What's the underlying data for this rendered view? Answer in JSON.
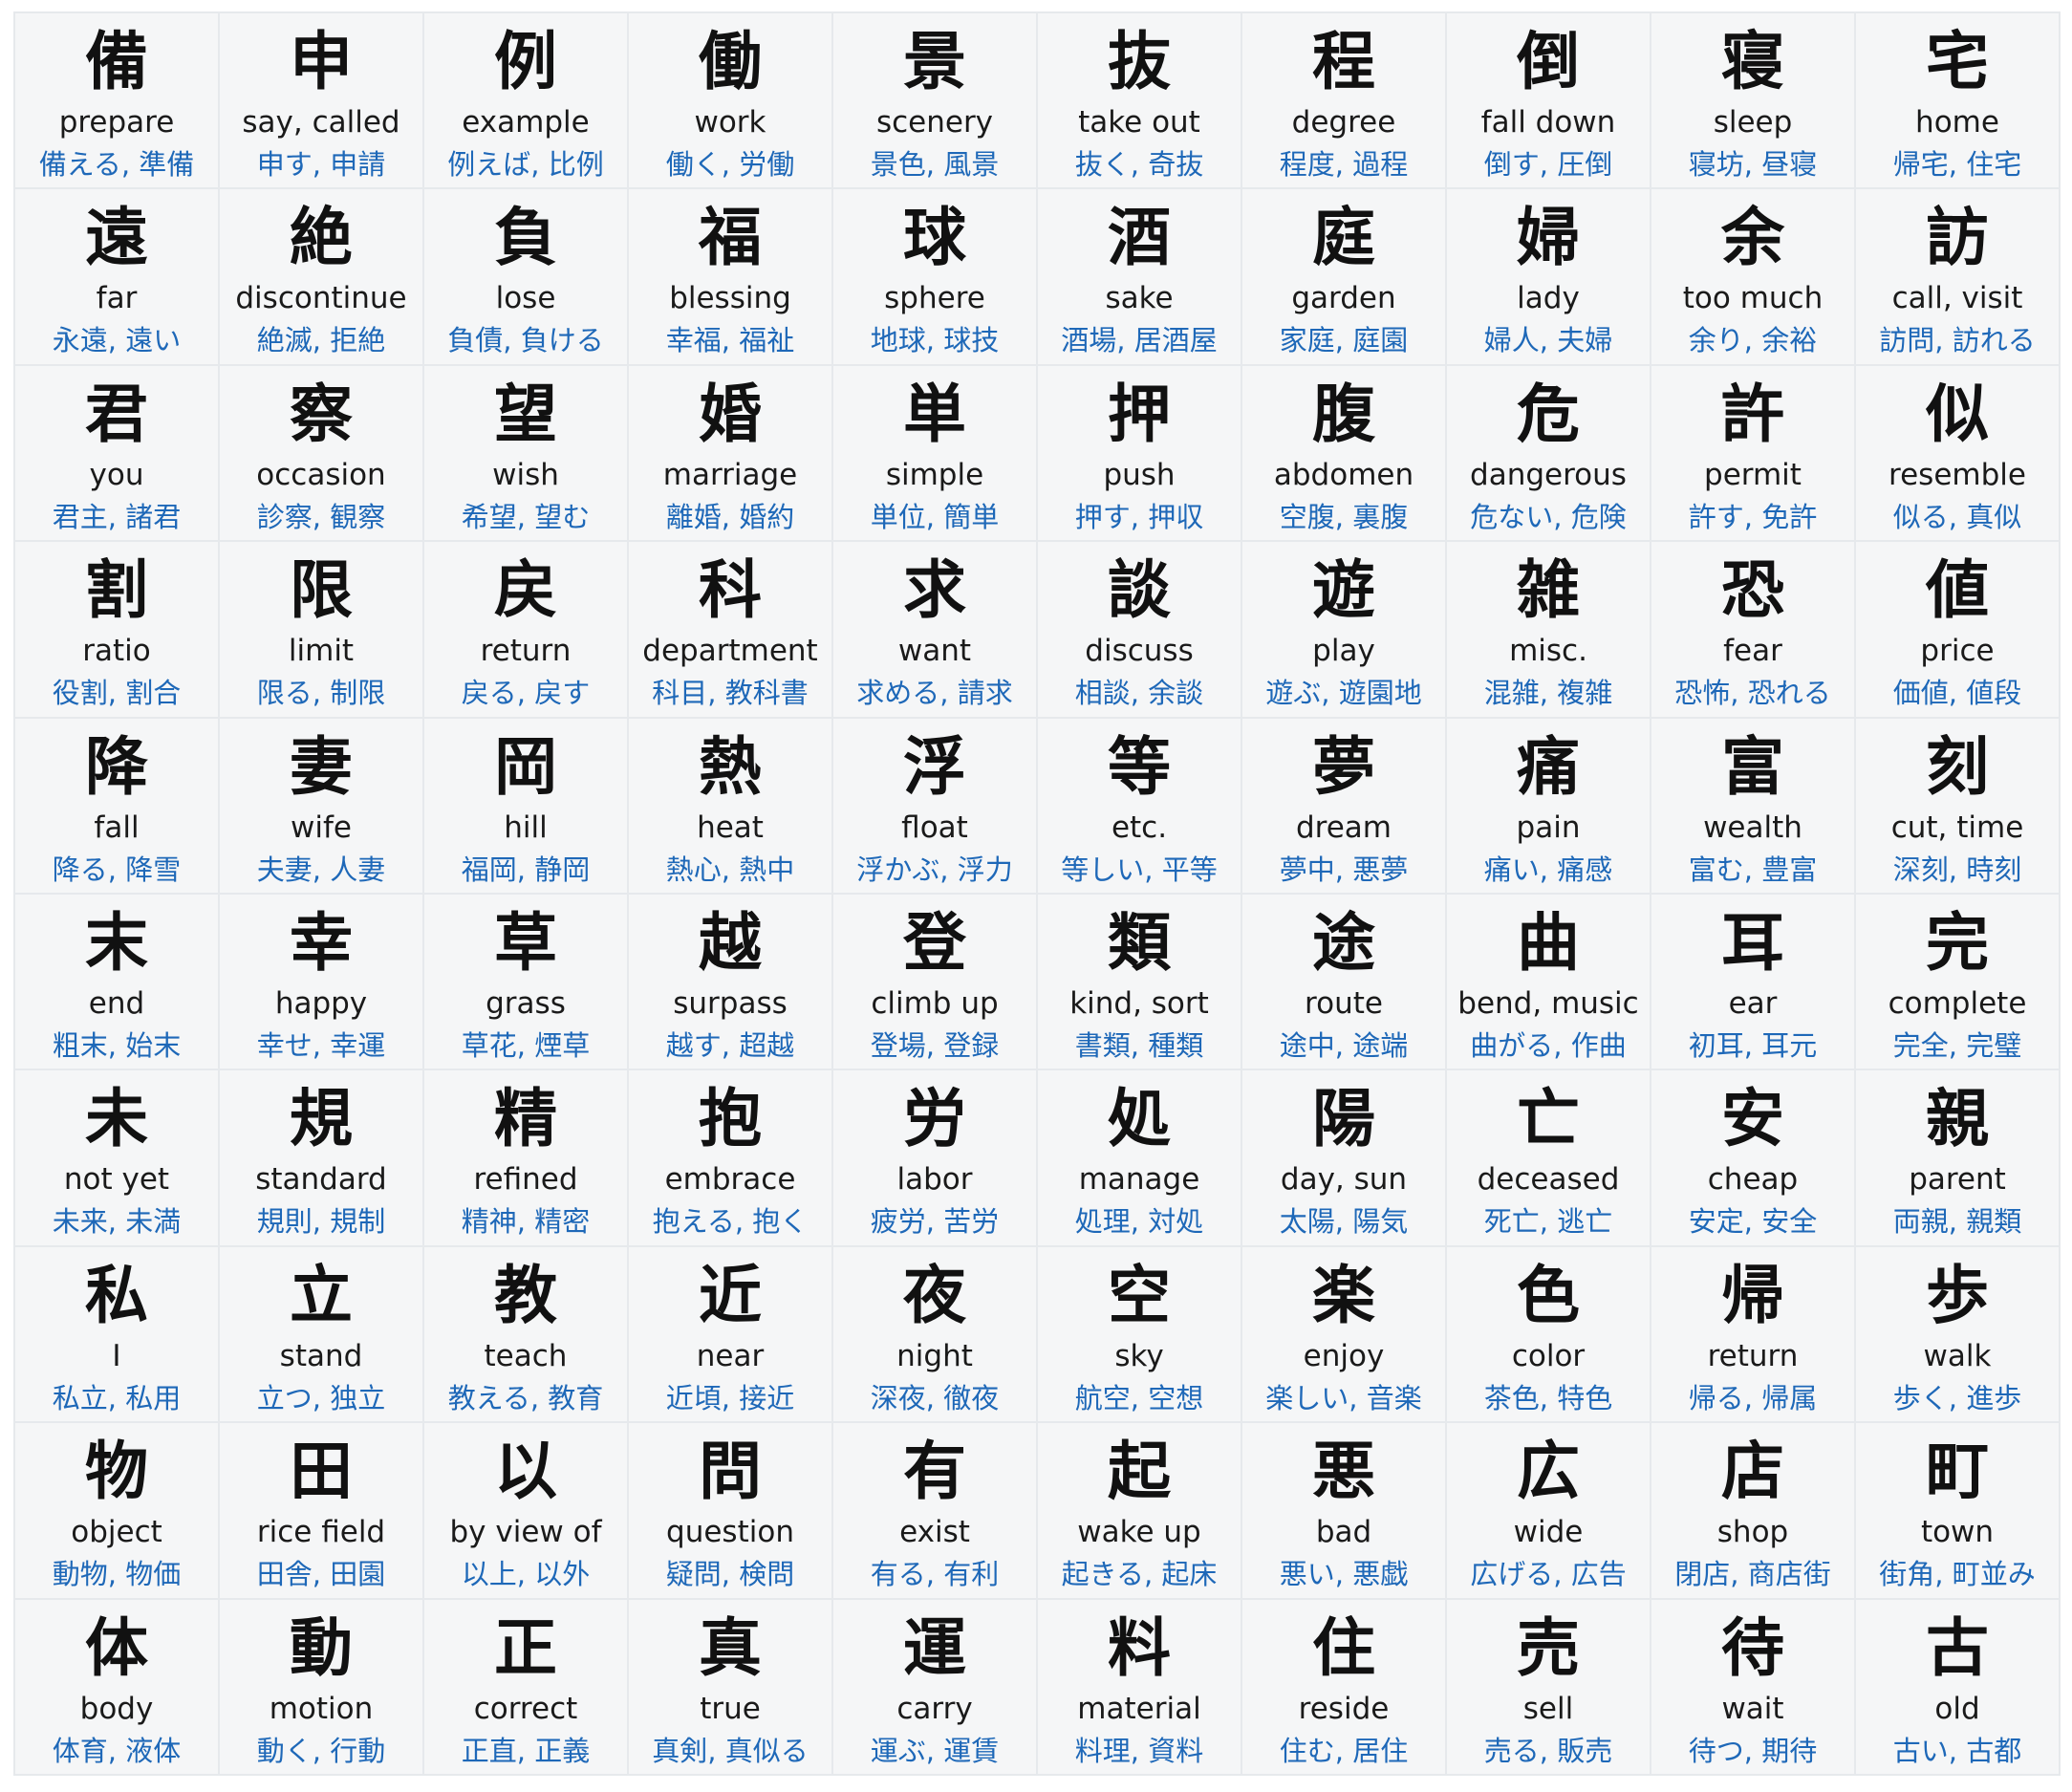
{
  "cells": [
    {
      "kanji": "備",
      "meaning": "prepare",
      "examples": "備える, 準備"
    },
    {
      "kanji": "申",
      "meaning": "say, called",
      "examples": "申す, 申請"
    },
    {
      "kanji": "例",
      "meaning": "example",
      "examples": "例えば, 比例"
    },
    {
      "kanji": "働",
      "meaning": "work",
      "examples": "働く, 労働"
    },
    {
      "kanji": "景",
      "meaning": "scenery",
      "examples": "景色, 風景"
    },
    {
      "kanji": "抜",
      "meaning": "take out",
      "examples": "抜く, 奇抜"
    },
    {
      "kanji": "程",
      "meaning": "degree",
      "examples": "程度, 過程"
    },
    {
      "kanji": "倒",
      "meaning": "fall down",
      "examples": "倒す, 圧倒"
    },
    {
      "kanji": "寝",
      "meaning": "sleep",
      "examples": "寝坊, 昼寝"
    },
    {
      "kanji": "宅",
      "meaning": "home",
      "examples": "帰宅, 住宅"
    },
    {
      "kanji": "遠",
      "meaning": "far",
      "examples": "永遠, 遠い"
    },
    {
      "kanji": "絶",
      "meaning": "discontinue",
      "examples": "絶滅, 拒絶"
    },
    {
      "kanji": "負",
      "meaning": "lose",
      "examples": "負債, 負ける"
    },
    {
      "kanji": "福",
      "meaning": "blessing",
      "examples": "幸福, 福祉"
    },
    {
      "kanji": "球",
      "meaning": "sphere",
      "examples": "地球, 球技"
    },
    {
      "kanji": "酒",
      "meaning": "sake",
      "examples": "酒場, 居酒屋"
    },
    {
      "kanji": "庭",
      "meaning": "garden",
      "examples": "家庭, 庭園"
    },
    {
      "kanji": "婦",
      "meaning": "lady",
      "examples": "婦人, 夫婦"
    },
    {
      "kanji": "余",
      "meaning": "too much",
      "examples": "余り, 余裕"
    },
    {
      "kanji": "訪",
      "meaning": "call, visit",
      "examples": "訪問, 訪れる"
    },
    {
      "kanji": "君",
      "meaning": "you",
      "examples": "君主, 諸君"
    },
    {
      "kanji": "察",
      "meaning": "occasion",
      "examples": "診察, 観察"
    },
    {
      "kanji": "望",
      "meaning": "wish",
      "examples": "希望, 望む"
    },
    {
      "kanji": "婚",
      "meaning": "marriage",
      "examples": "離婚, 婚約"
    },
    {
      "kanji": "単",
      "meaning": "simple",
      "examples": "単位, 簡単"
    },
    {
      "kanji": "押",
      "meaning": "push",
      "examples": "押す, 押収"
    },
    {
      "kanji": "腹",
      "meaning": "abdomen",
      "examples": "空腹, 裏腹"
    },
    {
      "kanji": "危",
      "meaning": "dangerous",
      "examples": "危ない, 危険"
    },
    {
      "kanji": "許",
      "meaning": "permit",
      "examples": "許す, 免許"
    },
    {
      "kanji": "似",
      "meaning": "resemble",
      "examples": "似る, 真似"
    },
    {
      "kanji": "割",
      "meaning": "ratio",
      "examples": "役割, 割合"
    },
    {
      "kanji": "限",
      "meaning": "limit",
      "examples": "限る, 制限"
    },
    {
      "kanji": "戻",
      "meaning": "return",
      "examples": "戻る, 戻す"
    },
    {
      "kanji": "科",
      "meaning": "department",
      "examples": "科目, 教科書"
    },
    {
      "kanji": "求",
      "meaning": "want",
      "examples": "求める, 請求"
    },
    {
      "kanji": "談",
      "meaning": "discuss",
      "examples": "相談, 余談"
    },
    {
      "kanji": "遊",
      "meaning": "play",
      "examples": "遊ぶ, 遊園地"
    },
    {
      "kanji": "雑",
      "meaning": "misc.",
      "examples": "混雑, 複雑"
    },
    {
      "kanji": "恐",
      "meaning": "fear",
      "examples": "恐怖, 恐れる"
    },
    {
      "kanji": "値",
      "meaning": "price",
      "examples": "価値, 値段"
    },
    {
      "kanji": "降",
      "meaning": "fall",
      "examples": "降る, 降雪"
    },
    {
      "kanji": "妻",
      "meaning": "wife",
      "examples": "夫妻, 人妻"
    },
    {
      "kanji": "岡",
      "meaning": "hill",
      "examples": "福岡, 静岡"
    },
    {
      "kanji": "熱",
      "meaning": "heat",
      "examples": "熱心, 熱中"
    },
    {
      "kanji": "浮",
      "meaning": "float",
      "examples": "浮かぶ, 浮力"
    },
    {
      "kanji": "等",
      "meaning": "etc.",
      "examples": "等しい, 平等"
    },
    {
      "kanji": "夢",
      "meaning": "dream",
      "examples": "夢中, 悪夢"
    },
    {
      "kanji": "痛",
      "meaning": "pain",
      "examples": "痛い, 痛感"
    },
    {
      "kanji": "富",
      "meaning": "wealth",
      "examples": "富む, 豊富"
    },
    {
      "kanji": "刻",
      "meaning": "cut, time",
      "examples": "深刻, 時刻"
    },
    {
      "kanji": "末",
      "meaning": "end",
      "examples": "粗末, 始末"
    },
    {
      "kanji": "幸",
      "meaning": "happy",
      "examples": "幸せ, 幸運"
    },
    {
      "kanji": "草",
      "meaning": "grass",
      "examples": "草花, 煙草"
    },
    {
      "kanji": "越",
      "meaning": "surpass",
      "examples": "越す, 超越"
    },
    {
      "kanji": "登",
      "meaning": "climb up",
      "examples": "登場, 登録"
    },
    {
      "kanji": "類",
      "meaning": "kind, sort",
      "examples": "書類, 種類"
    },
    {
      "kanji": "途",
      "meaning": "route",
      "examples": "途中, 途端"
    },
    {
      "kanji": "曲",
      "meaning": "bend, music",
      "examples": "曲がる, 作曲"
    },
    {
      "kanji": "耳",
      "meaning": "ear",
      "examples": "初耳, 耳元"
    },
    {
      "kanji": "完",
      "meaning": "complete",
      "examples": "完全, 完璧"
    },
    {
      "kanji": "未",
      "meaning": "not yet",
      "examples": "未来, 未満"
    },
    {
      "kanji": "規",
      "meaning": "standard",
      "examples": "規則, 規制"
    },
    {
      "kanji": "精",
      "meaning": "refined",
      "examples": "精神, 精密"
    },
    {
      "kanji": "抱",
      "meaning": "embrace",
      "examples": "抱える, 抱く"
    },
    {
      "kanji": "労",
      "meaning": "labor",
      "examples": "疲労, 苦労"
    },
    {
      "kanji": "処",
      "meaning": "manage",
      "examples": "処理, 対処"
    },
    {
      "kanji": "陽",
      "meaning": "day, sun",
      "examples": "太陽, 陽気"
    },
    {
      "kanji": "亡",
      "meaning": "deceased",
      "examples": "死亡, 逃亡"
    },
    {
      "kanji": "安",
      "meaning": "cheap",
      "examples": "安定, 安全"
    },
    {
      "kanji": "親",
      "meaning": "parent",
      "examples": "両親, 親類"
    },
    {
      "kanji": "私",
      "meaning": "I",
      "examples": "私立, 私用"
    },
    {
      "kanji": "立",
      "meaning": "stand",
      "examples": "立つ, 独立"
    },
    {
      "kanji": "教",
      "meaning": "teach",
      "examples": "教える, 教育"
    },
    {
      "kanji": "近",
      "meaning": "near",
      "examples": "近頃, 接近"
    },
    {
      "kanji": "夜",
      "meaning": "night",
      "examples": "深夜, 徹夜"
    },
    {
      "kanji": "空",
      "meaning": "sky",
      "examples": "航空, 空想"
    },
    {
      "kanji": "楽",
      "meaning": "enjoy",
      "examples": "楽しい, 音楽"
    },
    {
      "kanji": "色",
      "meaning": "color",
      "examples": "茶色, 特色"
    },
    {
      "kanji": "帰",
      "meaning": "return",
      "examples": "帰る, 帰属"
    },
    {
      "kanji": "歩",
      "meaning": "walk",
      "examples": "歩く, 進歩"
    },
    {
      "kanji": "物",
      "meaning": "object",
      "examples": "動物, 物価"
    },
    {
      "kanji": "田",
      "meaning": "rice field",
      "examples": "田舎, 田園"
    },
    {
      "kanji": "以",
      "meaning": "by view of",
      "examples": "以上, 以外"
    },
    {
      "kanji": "問",
      "meaning": "question",
      "examples": "疑問, 検問"
    },
    {
      "kanji": "有",
      "meaning": "exist",
      "examples": "有る, 有利"
    },
    {
      "kanji": "起",
      "meaning": "wake up",
      "examples": "起きる, 起床"
    },
    {
      "kanji": "悪",
      "meaning": "bad",
      "examples": "悪い, 悪戯"
    },
    {
      "kanji": "広",
      "meaning": "wide",
      "examples": "広げる, 広告"
    },
    {
      "kanji": "店",
      "meaning": "shop",
      "examples": "閉店, 商店街"
    },
    {
      "kanji": "町",
      "meaning": "town",
      "examples": "街角, 町並み"
    },
    {
      "kanji": "体",
      "meaning": "body",
      "examples": "体育, 液体"
    },
    {
      "kanji": "動",
      "meaning": "motion",
      "examples": "動く, 行動"
    },
    {
      "kanji": "正",
      "meaning": "correct",
      "examples": "正直, 正義"
    },
    {
      "kanji": "真",
      "meaning": "true",
      "examples": "真剣, 真似る"
    },
    {
      "kanji": "運",
      "meaning": "carry",
      "examples": "運ぶ, 運賃"
    },
    {
      "kanji": "料",
      "meaning": "material",
      "examples": "料理, 資料"
    },
    {
      "kanji": "住",
      "meaning": "reside",
      "examples": "住む, 居住"
    },
    {
      "kanji": "売",
      "meaning": "sell",
      "examples": "売る, 販売"
    },
    {
      "kanji": "待",
      "meaning": "wait",
      "examples": "待つ, 期待"
    },
    {
      "kanji": "古",
      "meaning": "old",
      "examples": "古い, 古都"
    }
  ],
  "colors": {
    "kanji": "#111111",
    "meaning": "#1a1a1a",
    "examples": "#1e68b8",
    "cell_bg": "#f5f6f7",
    "grid_line": "#e6e9ec"
  }
}
